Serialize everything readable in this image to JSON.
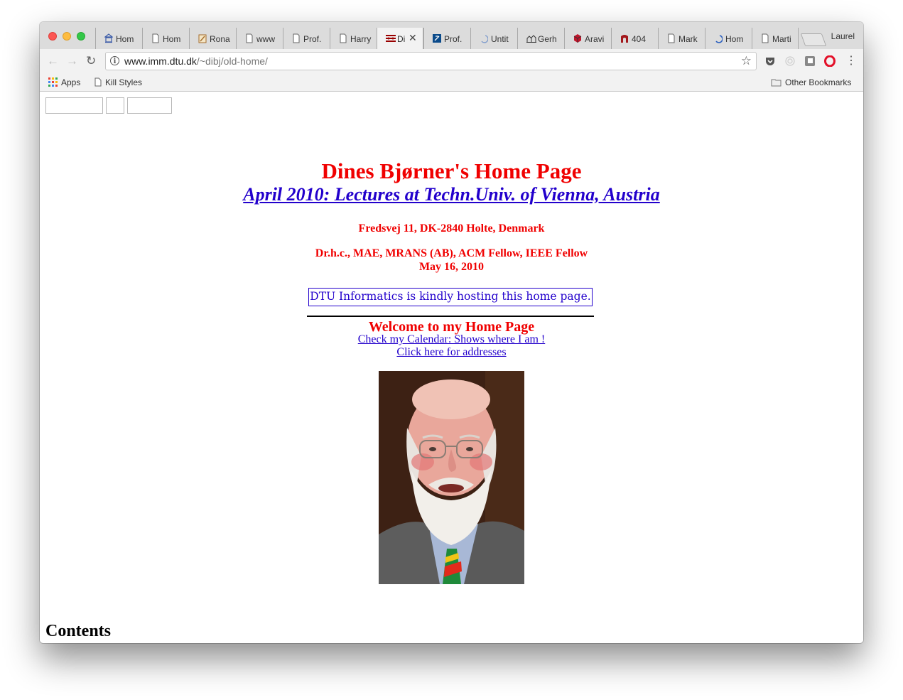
{
  "browser": {
    "tabs": [
      {
        "label": "Hom",
        "icon": "building-icon"
      },
      {
        "label": "Hom",
        "icon": "page-icon"
      },
      {
        "label": "Rona",
        "icon": "pencil-icon"
      },
      {
        "label": "www",
        "icon": "page-icon"
      },
      {
        "label": "Prof.",
        "icon": "page-icon"
      },
      {
        "label": "Harry",
        "icon": "page-icon"
      },
      {
        "label": "Di",
        "icon": "dtu-logo-icon",
        "active": true
      },
      {
        "label": "Prof.",
        "icon": "logo-icon"
      },
      {
        "label": "Untit",
        "icon": "spinner-icon"
      },
      {
        "label": "Gerh",
        "icon": "building-icon"
      },
      {
        "label": "Aravi",
        "icon": "cube-icon"
      },
      {
        "label": "404",
        "icon": "arch-icon"
      },
      {
        "label": "Mark",
        "icon": "page-icon"
      },
      {
        "label": "Hom",
        "icon": "spinner-icon"
      },
      {
        "label": "Marti",
        "icon": "page-icon"
      }
    ],
    "profile_name": "Laurel",
    "url_host": "www.imm.dtu.dk",
    "url_path": "/~dibj/old-home/",
    "bookmarks": {
      "apps": "Apps",
      "kill_styles": "Kill Styles",
      "other": "Other Bookmarks"
    }
  },
  "page": {
    "title": "Dines Bjørner's Home Page",
    "subtitle_link": "April 2010: Lectures at Techn.Univ. of Vienna, Austria",
    "address": "Fredsvej 11, DK-2840 Holte, Denmark",
    "credentials": "Dr.h.c., MAE, MRANS (AB), ACM Fellow, IEEE Fellow",
    "date": "May 16, 2010",
    "hosting_note": "DTU Informatics is kindly hosting this home page.",
    "welcome": "Welcome to my Home Page",
    "calendar_link": "Check my Calendar: Shows where I am !",
    "addresses_link": "Click here for addresses",
    "contents_heading": "Contents"
  },
  "colors": {
    "heading_red": "#f00000",
    "link_blue": "#2200cc"
  }
}
